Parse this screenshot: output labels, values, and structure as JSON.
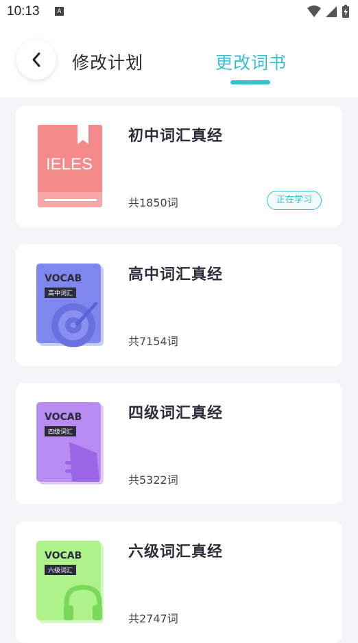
{
  "status_bar": {
    "time": "10:13",
    "notification_glyph": "A",
    "icons": [
      "wifi-icon",
      "signal-icon",
      "battery-charging-icon"
    ]
  },
  "header": {
    "back_icon": "chevron-left-icon",
    "tab_plan_label": "修改计划",
    "tab_book_label": "更改词书",
    "active_tab": "更改词书",
    "accent_color": "#35c0d2"
  },
  "books": [
    {
      "title": "初中词汇真经",
      "count": "共1850词",
      "cover_text": "IELES",
      "cover_color": "#f48a8a",
      "badge": "正在学习"
    },
    {
      "title": "高中词汇真经",
      "count": "共7154词",
      "cover_word": "VOCAB",
      "cover_tag": "高中词汇",
      "cover_color": "#7f86ee",
      "cover_icon": "target-icon"
    },
    {
      "title": "四级词汇真经",
      "count": "共5322词",
      "cover_word": "VOCAB",
      "cover_tag": "四级词汇",
      "cover_color": "#b98cf2",
      "cover_icon": "airplane-icon"
    },
    {
      "title": "六级词汇真经",
      "count": "共2747词",
      "cover_word": "VOCAB",
      "cover_tag": "六级词汇",
      "cover_color": "#aef38a",
      "cover_icon": "headphones-icon"
    }
  ]
}
